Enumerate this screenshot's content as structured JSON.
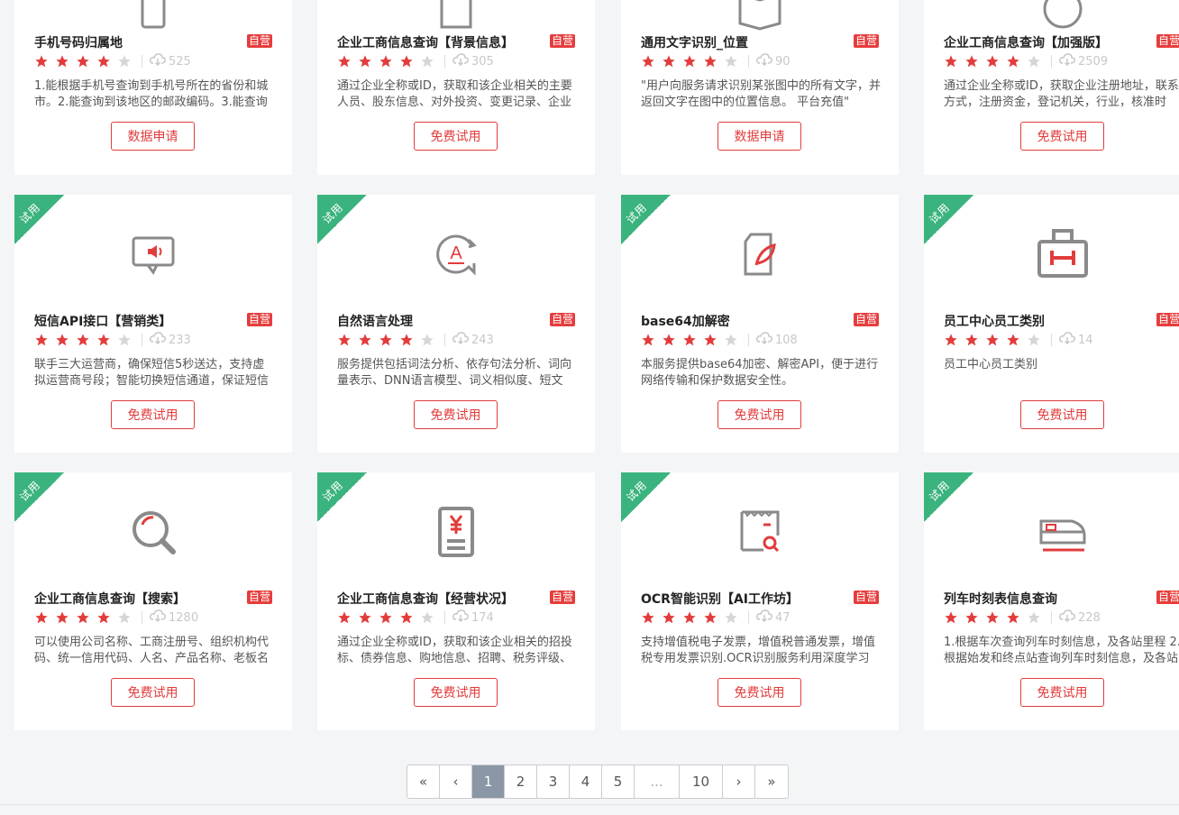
{
  "ribbon_label": "试用",
  "badge_label": "自营",
  "cards": [
    {
      "title": "手机号码归属地",
      "rating": 4,
      "downloads": "525",
      "desc": "1.能根据手机号查询到手机号所在的省份和城市。2.能查询到该地区的邮政编码。3.能查询",
      "button": "数据申请",
      "icon": "phone-icon"
    },
    {
      "title": "企业工商信息查询【背景信息】",
      "rating": 4,
      "downloads": "305",
      "desc": "通过企业全称或ID，获取和该企业相关的主要人员、股东信息、对外投资、变更记录、企业",
      "button": "免费试用",
      "icon": "building-icon"
    },
    {
      "title": "通用文字识别_位置",
      "rating": 4,
      "downloads": "90",
      "desc": "\"用户向服务请求识别某张图中的所有文字，并返回文字在图中的位置信息。 平台充值\"",
      "button": "数据申请",
      "icon": "book-icon"
    },
    {
      "title": "企业工商信息查询【加强版】",
      "rating": 4,
      "downloads": "2509",
      "desc": "通过企业全称或ID，获取企业注册地址，联系方式，注册资金，登记机关，行业，核准时",
      "button": "免费试用",
      "icon": "circle-icon"
    },
    {
      "title": "短信API接口【营销类】",
      "rating": 4,
      "downloads": "233",
      "desc": "联手三大运营商，确保短信5秒送达，支持虚拟运营商号段；智能切换短信通道，保证短信",
      "button": "免费试用",
      "icon": "sms-icon"
    },
    {
      "title": "自然语言处理",
      "rating": 4,
      "downloads": "243",
      "desc": "服务提供包括词法分析、依存句法分析、词向量表示、DNN语言模型、词义相似度、短文",
      "button": "免费试用",
      "icon": "language-icon"
    },
    {
      "title": "base64加解密",
      "rating": 4,
      "downloads": "108",
      "desc": "本服务提供base64加密、解密API，便于进行网络传输和保护数据安全性。",
      "button": "免费试用",
      "icon": "document-feather-icon"
    },
    {
      "title": "员工中心员工类别",
      "rating": 4,
      "downloads": "14",
      "desc": "员工中心员工类别",
      "button": "免费试用",
      "icon": "briefcase-icon"
    },
    {
      "title": "企业工商信息查询【搜索】",
      "rating": 4,
      "downloads": "1280",
      "desc": "可以使用公司名称、工商注册号、组织机构代码、统一信用代码、人名、产品名称、老板名",
      "button": "免费试用",
      "icon": "search-icon"
    },
    {
      "title": "企业工商信息查询【经营状况】",
      "rating": 4,
      "downloads": "174",
      "desc": "通过企业全称或ID，获取和该企业相关的招投标、债券信息、购地信息、招聘、税务评级、",
      "button": "免费试用",
      "icon": "invoice-yen-icon"
    },
    {
      "title": "OCR智能识别【AI工作坊】",
      "rating": 4,
      "downloads": "47",
      "desc": "支持增值税电子发票，增值税普通发票，增值税专用发票识别.OCR识别服务利用深度学习",
      "button": "免费试用",
      "icon": "receipt-search-icon"
    },
    {
      "title": "列车时刻表信息查询",
      "rating": 4,
      "downloads": "228",
      "desc": "1.根据车次查询列车时刻信息，及各站里程 2.根据始发和终点站查询列车时刻信息，及各站",
      "button": "免费试用",
      "icon": "train-icon"
    }
  ],
  "pagination": {
    "first": "«",
    "prev": "‹",
    "pages": [
      "1",
      "2",
      "3",
      "4",
      "5"
    ],
    "dots": "...",
    "last_page": "10",
    "next": "›",
    "last": "»",
    "current": "1"
  },
  "colors": {
    "accent": "#e23c3c",
    "ribbon": "#3bb37e",
    "icon_gray": "#8a8a8a",
    "active_page": "#8b97a6"
  }
}
